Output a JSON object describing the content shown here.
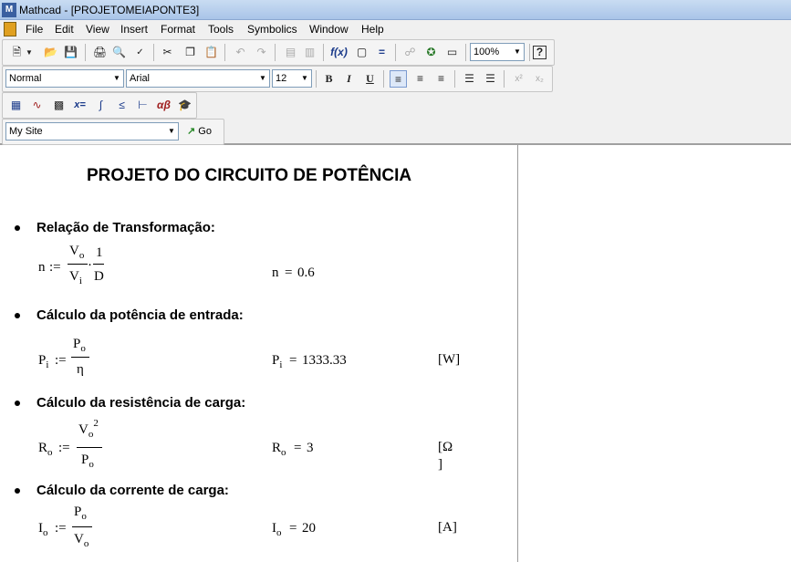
{
  "window": {
    "title": "Mathcad - [PROJETOMEIAPONTE3]"
  },
  "menu": {
    "items": [
      "File",
      "Edit",
      "View",
      "Insert",
      "Format",
      "Tools",
      "Symbolics",
      "Window",
      "Help"
    ]
  },
  "toolbar_standard": {
    "zoom": "100%"
  },
  "toolbar_formatting": {
    "style": "Normal",
    "font": "Arial",
    "size": "12",
    "bold": "B",
    "italic": "I",
    "underline": "U"
  },
  "toolbar_math": {
    "eval_label": "x=",
    "greek_label": "αβ"
  },
  "toolbar_resources": {
    "site": "My Site",
    "go_label": "Go"
  },
  "document": {
    "title": "PROJETO DO CIRCUITO DE POTÊNCIA",
    "sections": [
      {
        "heading": "Relação de Transformação:",
        "def_lhs": "n",
        "def_op": ":=",
        "num1": "V",
        "num1_sub": "o",
        "den1": "V",
        "den1_sub": "i",
        "mult": "·",
        "num2": "1",
        "den2": "D",
        "result_lhs": "n",
        "result_eq": "=",
        "result_value": "0.6"
      },
      {
        "heading": "Cálculo da potência de entrada:",
        "def_lhs": "P",
        "def_lhs_sub": "i",
        "def_op": ":=",
        "num": "P",
        "num_sub": "o",
        "den": "η",
        "result_lhs": "P",
        "result_lhs_sub": "i",
        "result_eq": "=",
        "result_value": "1333.33",
        "unit": "[W]"
      },
      {
        "heading": "Cálculo da resistência de carga:",
        "def_lhs": "R",
        "def_lhs_sub": "o",
        "def_op": ":=",
        "num": "V",
        "num_sub": "o",
        "num_sup": "2",
        "den": "P",
        "den_sub": "o",
        "result_lhs": "R",
        "result_lhs_sub": "o",
        "result_eq": "=",
        "result_value": "3",
        "unit_line1": "[Ω",
        "unit_line2": "]"
      },
      {
        "heading": "Cálculo da corrente de carga:",
        "def_lhs": "I",
        "def_lhs_sub": "o",
        "def_op": ":=",
        "num": "P",
        "num_sub": "o",
        "den": "V",
        "den_sub": "o",
        "result_lhs": "I",
        "result_lhs_sub": "o",
        "result_eq": "=",
        "result_value": "20",
        "unit": "[A]"
      }
    ]
  }
}
